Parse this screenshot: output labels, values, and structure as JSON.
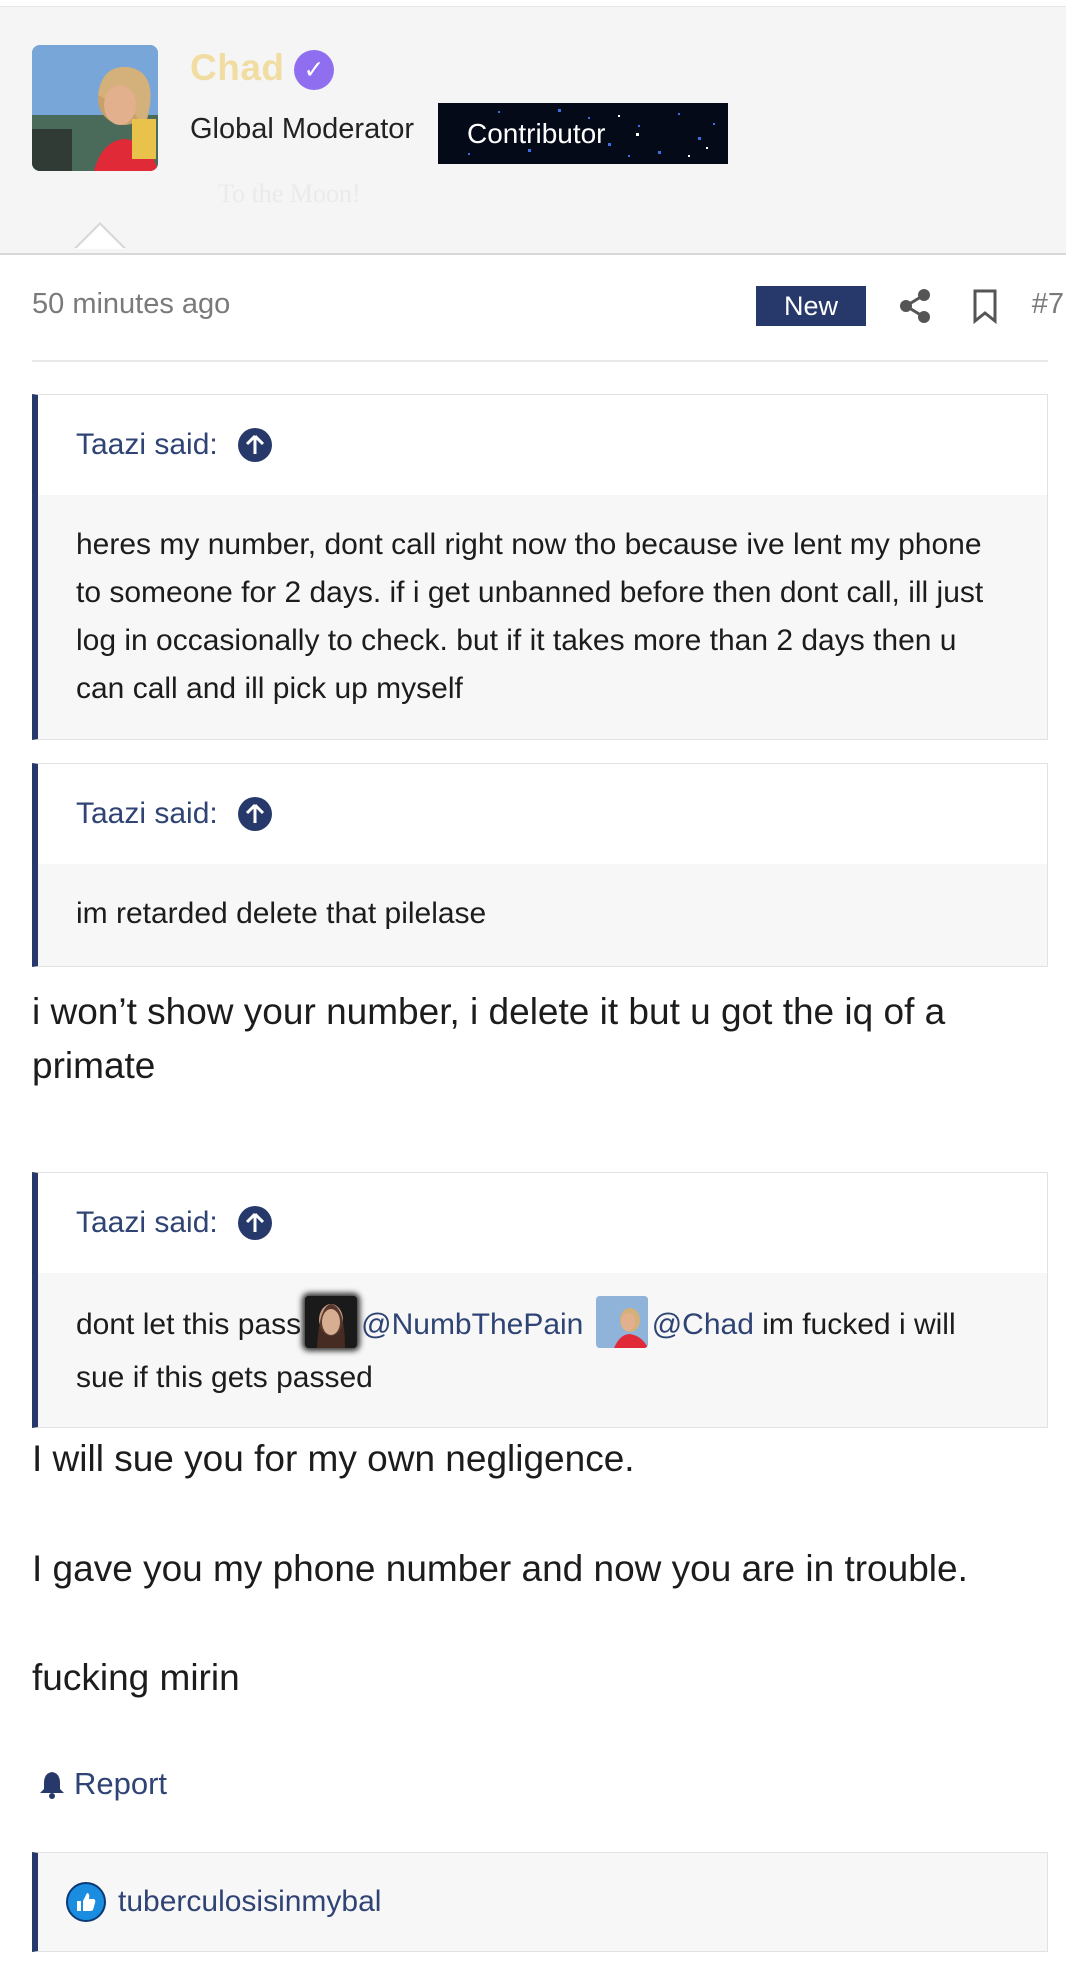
{
  "user": {
    "name": "Chad",
    "role": "Global Moderator",
    "badge": "Contributor",
    "tagline": "To the Moon!"
  },
  "post": {
    "timestamp": "50 minutes ago",
    "new_badge": "New",
    "number": "#7"
  },
  "quotes": [
    {
      "author": "Taazi said:",
      "text": "heres my number, dont call right now tho because ive lent my phone to someone for 2 days. if i get unbanned before then dont call, ill just log in occasionally to check. but if it takes more than 2 days then u can call and ill pick up myself"
    },
    {
      "author": "Taazi said:",
      "text": "im retarded delete that pilelase"
    },
    {
      "author": "Taazi said:",
      "text_before": "dont let this pass",
      "mention1": "@NumbThePain",
      "mention2": "@Chad",
      "text_after": "im fucked i will sue if this gets passed"
    }
  ],
  "replies": [
    "i won’t show your number, i delete it but u got the iq of a primate",
    "I will sue you for my own negligence.",
    "I gave you my phone number and now you are in trouble.",
    "fucking mirin"
  ],
  "actions": {
    "report": "Report"
  },
  "reactions": {
    "user": "tuberculosisinmybal"
  }
}
